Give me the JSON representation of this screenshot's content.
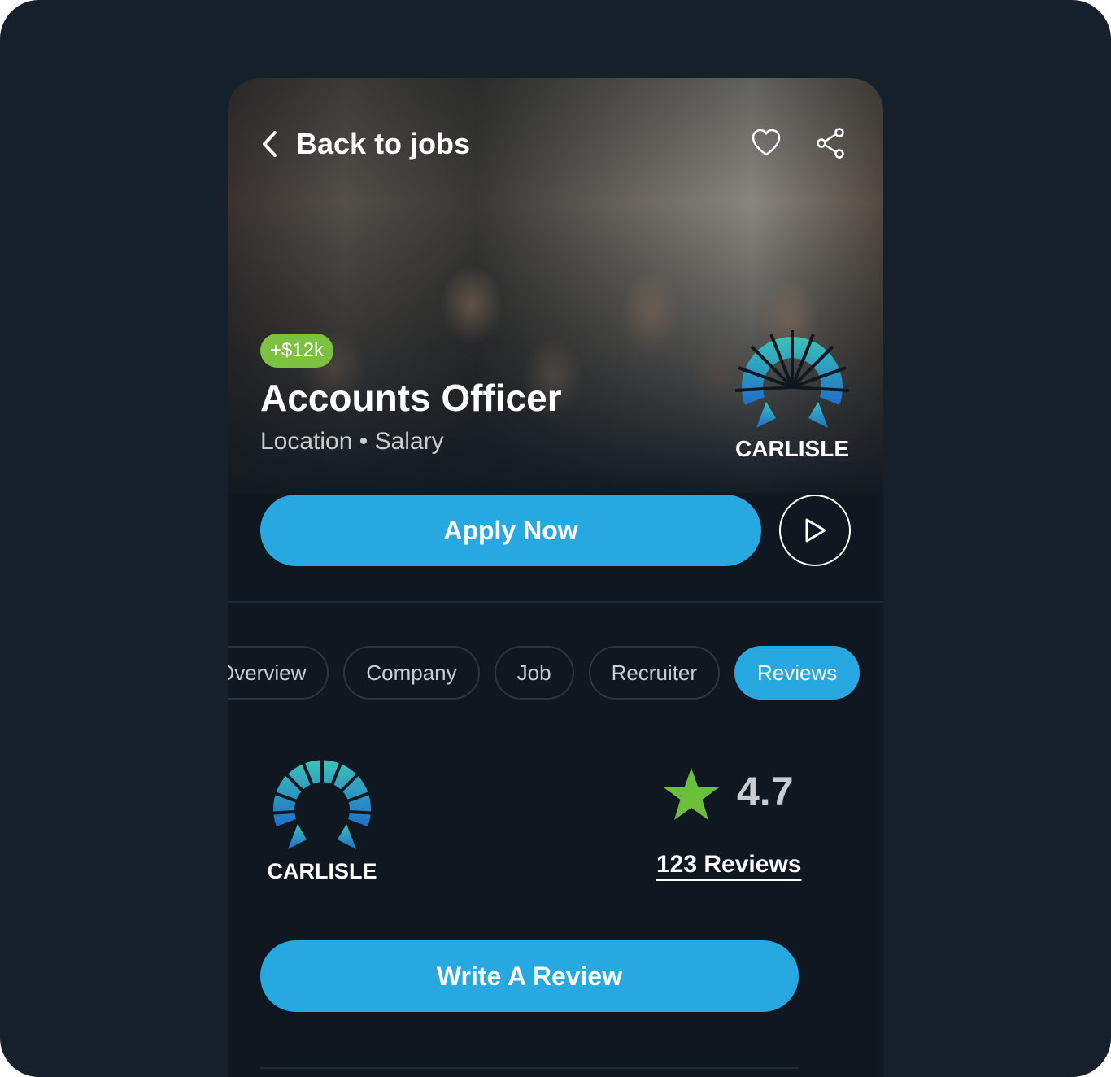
{
  "header": {
    "back_label": "Back to jobs",
    "icons": [
      "chevron-left-icon",
      "heart-icon",
      "share-icon"
    ]
  },
  "job": {
    "bonus_badge": "+$12k",
    "title": "Accounts Officer",
    "meta": "Location • Salary"
  },
  "company": {
    "name": "CARLISLE"
  },
  "actions": {
    "apply_label": "Apply Now",
    "play_icon": "play-icon"
  },
  "tabs": [
    {
      "label": "Overview",
      "active": false
    },
    {
      "label": "Company",
      "active": false
    },
    {
      "label": "Job",
      "active": false
    },
    {
      "label": "Recruiter",
      "active": false
    },
    {
      "label": "Reviews",
      "active": true
    }
  ],
  "reviews": {
    "rating": "4.7",
    "count_label": "123 Reviews",
    "write_label": "Write A Review"
  },
  "colors": {
    "accent_blue": "#28a8e0",
    "badge_green": "#7dc142",
    "star_green": "#6cbf3a",
    "background": "#0f1820",
    "frame": "#16202a"
  }
}
